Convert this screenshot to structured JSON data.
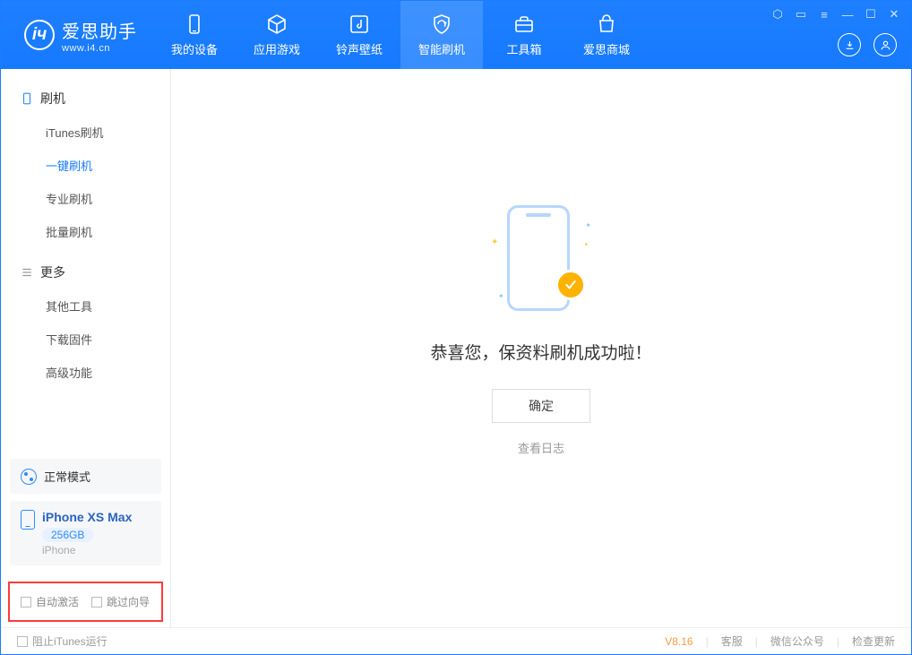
{
  "app": {
    "name": "爱思助手",
    "site": "www.i4.cn"
  },
  "nav": {
    "items": [
      {
        "label": "我的设备"
      },
      {
        "label": "应用游戏"
      },
      {
        "label": "铃声壁纸"
      },
      {
        "label": "智能刷机"
      },
      {
        "label": "工具箱"
      },
      {
        "label": "爱思商城"
      }
    ]
  },
  "sidebar": {
    "group1": {
      "title": "刷机",
      "items": [
        {
          "label": "iTunes刷机"
        },
        {
          "label": "一键刷机"
        },
        {
          "label": "专业刷机"
        },
        {
          "label": "批量刷机"
        }
      ]
    },
    "group2": {
      "title": "更多",
      "items": [
        {
          "label": "其他工具"
        },
        {
          "label": "下载固件"
        },
        {
          "label": "高级功能"
        }
      ]
    },
    "mode_label": "正常模式",
    "device": {
      "name": "iPhone XS Max",
      "storage": "256GB",
      "type": "iPhone"
    },
    "auto_activate": "自动激活",
    "skip_guide": "跳过向导"
  },
  "main": {
    "message": "恭喜您，保资料刷机成功啦！",
    "ok": "确定",
    "view_log": "查看日志"
  },
  "footer": {
    "block_itunes": "阻止iTunes运行",
    "version": "V8.16",
    "cs": "客服",
    "wechat": "微信公众号",
    "update": "检查更新"
  }
}
